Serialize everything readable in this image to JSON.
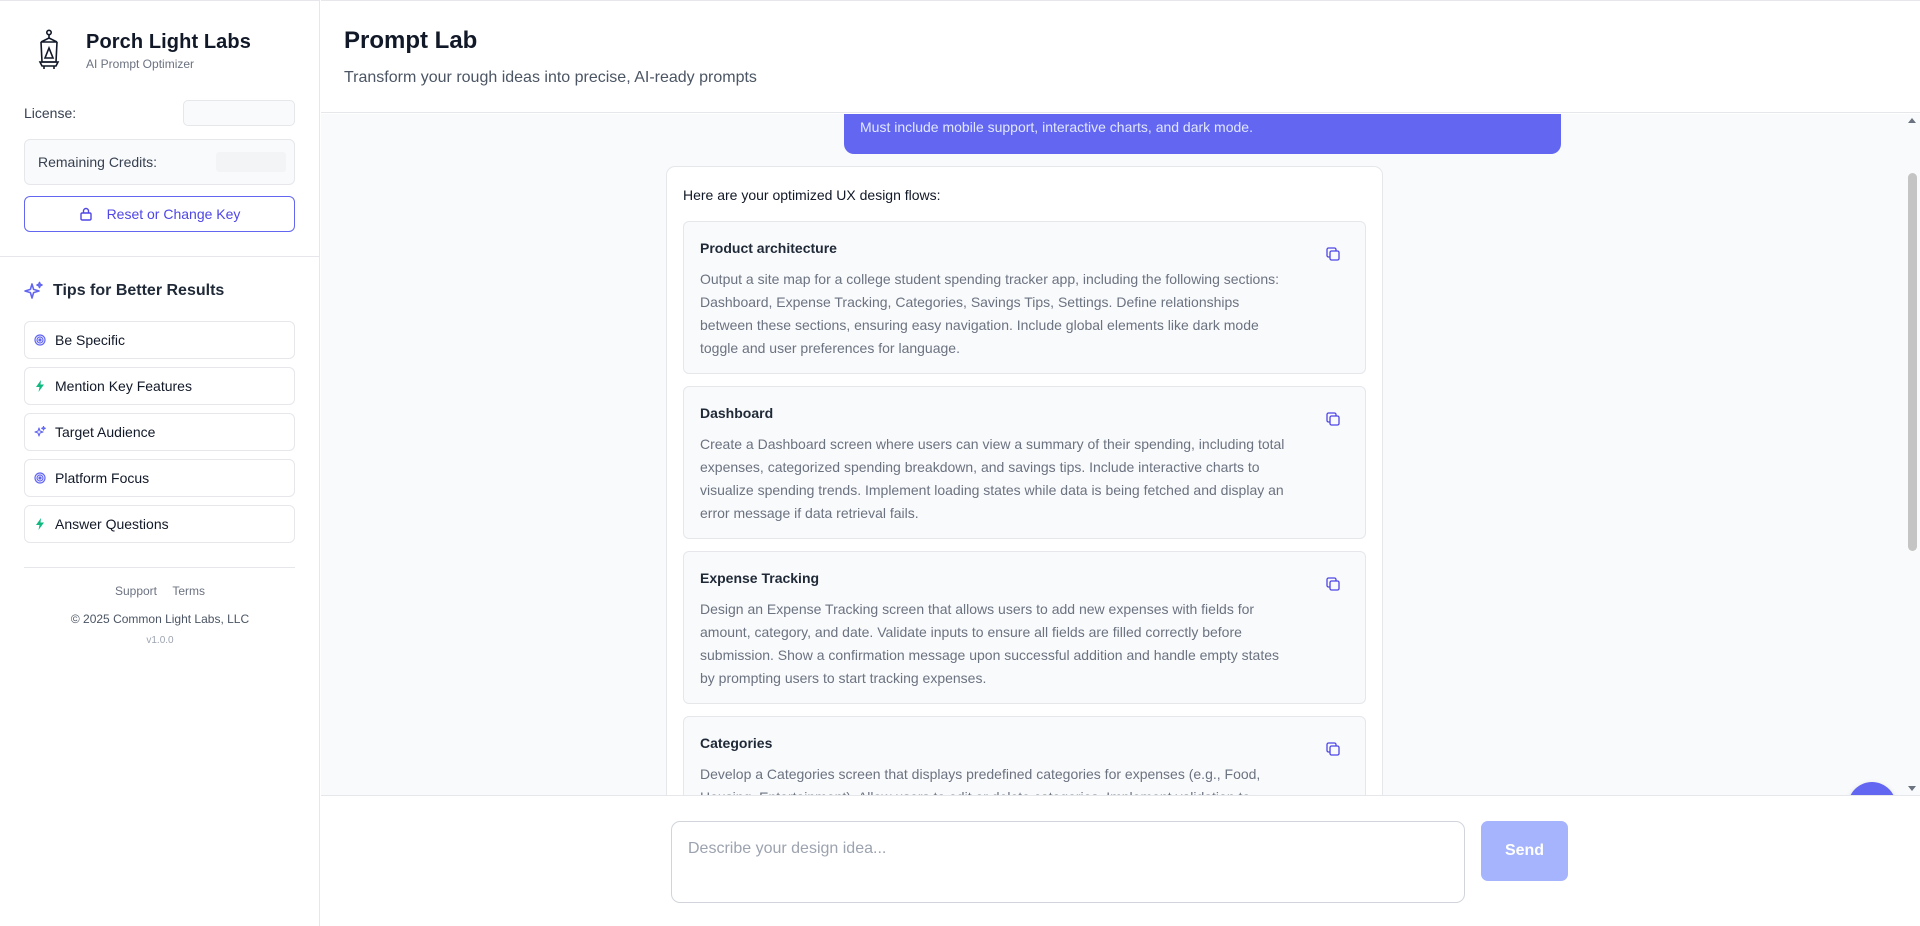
{
  "brand": {
    "name": "Porch Light Labs",
    "subtitle": "AI Prompt Optimizer"
  },
  "account": {
    "license_label": "License:",
    "credits_label": "Remaining Credits:",
    "reset_label": "Reset or Change Key"
  },
  "tips": {
    "title": "Tips for Better Results",
    "items": [
      {
        "label": "Be Specific",
        "icon": "target-icon"
      },
      {
        "label": "Mention Key Features",
        "icon": "bolt-icon"
      },
      {
        "label": "Target Audience",
        "icon": "sparkle-icon"
      },
      {
        "label": "Platform Focus",
        "icon": "target-icon"
      },
      {
        "label": "Answer Questions",
        "icon": "bolt-icon"
      }
    ]
  },
  "footer": {
    "support": "Support",
    "terms": "Terms",
    "copyright": "© 2025 Common Light Labs, LLC",
    "version": "v1.0.0"
  },
  "header": {
    "title": "Prompt Lab",
    "subtitle": "Transform your rough ideas into precise, AI-ready prompts"
  },
  "chat": {
    "user_message_tail": "Must include mobile support, interactive charts, and dark mode.",
    "ai_intro": "Here are your optimized UX design flows:",
    "flows": [
      {
        "title": "Product architecture",
        "body": "Output a site map for a college student spending tracker app, including the following sections: Dashboard, Expense Tracking, Categories, Savings Tips, Settings. Define relationships between these sections, ensuring easy navigation. Include global elements like dark mode toggle and user preferences for language."
      },
      {
        "title": "Dashboard",
        "body": "Create a Dashboard screen where users can view a summary of their spending, including total expenses, categorized spending breakdown, and savings tips. Include interactive charts to visualize spending trends. Implement loading states while data is being fetched and display an error message if data retrieval fails."
      },
      {
        "title": "Expense Tracking",
        "body": "Design an Expense Tracking screen that allows users to add new expenses with fields for amount, category, and date. Validate inputs to ensure all fields are filled correctly before submission. Show a confirmation message upon successful addition and handle empty states by prompting users to start tracking expenses."
      },
      {
        "title": "Categories",
        "body": "Develop a Categories screen that displays predefined categories for expenses (e.g., Food, Housing, Entertainment). Allow users to edit or delete categories. Implement validation to"
      }
    ]
  },
  "composer": {
    "placeholder": "Describe your design idea...",
    "send_label": "Send"
  },
  "colors": {
    "accent": "#6366f1",
    "accent_light": "#a5b4fc",
    "tip_green": "#10b981"
  }
}
